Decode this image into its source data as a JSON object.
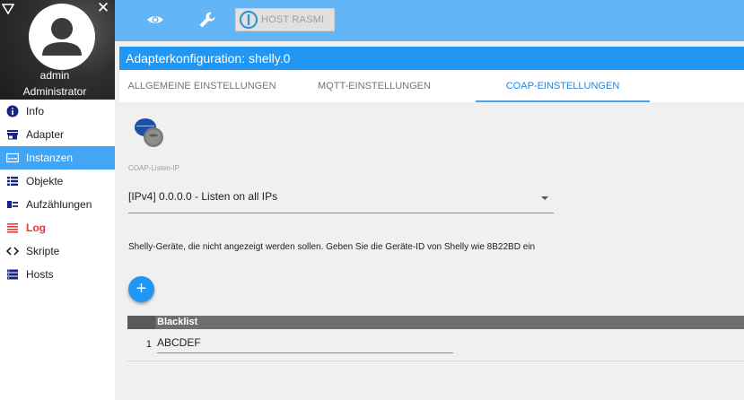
{
  "colors": {
    "topbar": "#64b5f6",
    "titlebar": "#2196f3",
    "nav_active": "#42a5f5",
    "log_red": "#e53935",
    "tab_active": "#1e88e5"
  },
  "profile": {
    "username": "admin",
    "role": "Administrator"
  },
  "nav": {
    "items": [
      {
        "label": "Info",
        "icon": "info-icon"
      },
      {
        "label": "Adapter",
        "icon": "store-icon"
      },
      {
        "label": "Instanzen",
        "icon": "instances-icon"
      },
      {
        "label": "Objekte",
        "icon": "list-icon"
      },
      {
        "label": "Aufzählungen",
        "icon": "enums-icon"
      },
      {
        "label": "Log",
        "icon": "log-icon"
      },
      {
        "label": "Skripte",
        "icon": "code-icon"
      },
      {
        "label": "Hosts",
        "icon": "storage-icon"
      }
    ],
    "active_index": 2
  },
  "topbar": {
    "host_label": "HOST RASMI"
  },
  "title": "Adapterkonfiguration: shelly.0",
  "tabs": [
    {
      "label": "ALLGEMEINE EINSTELLUNGEN"
    },
    {
      "label": "MQTT-EINSTELLUNGEN"
    },
    {
      "label": "COAP-EINSTELLUNGEN"
    }
  ],
  "coap": {
    "listen_ip_label": "COAP-Listen-IP",
    "listen_ip_value": "[IPv4] 0.0.0.0 - Listen on all IPs"
  },
  "blacklist": {
    "description": "Shelly-Geräte, die nicht angezeigt werden sollen. Geben Sie die Geräte-ID von Shelly wie 8B22BD ein",
    "add_label": "+",
    "column_header": "Blacklist",
    "rows": [
      {
        "num": "1",
        "value": "ABCDEF"
      }
    ]
  }
}
